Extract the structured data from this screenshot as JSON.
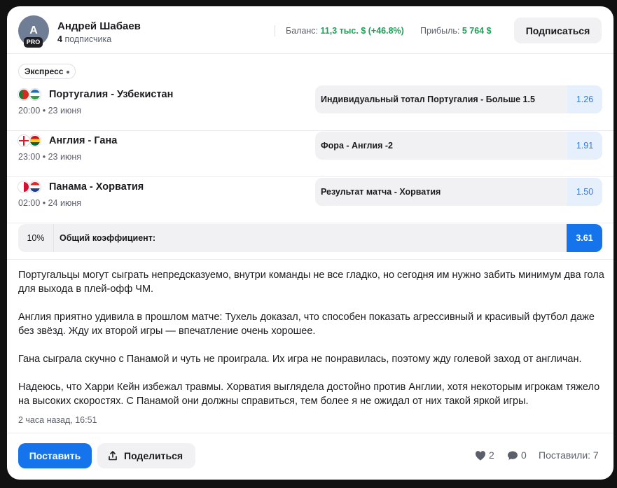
{
  "author": {
    "avatar_letter": "A",
    "badge": "PRO",
    "name": "Андрей Шабаев",
    "subscribers_count": "4",
    "subscribers_label": "подписчика"
  },
  "stats": {
    "balance_label": "Баланс:",
    "balance_value": "11,3 тыс. $ (+46.8%)",
    "profit_label": "Прибыль:",
    "profit_value": "5 764 $"
  },
  "subscribe_label": "Подписаться",
  "bet_type": "Экспресс",
  "matches": [
    {
      "title": "Португалия - Узбекистан",
      "time": "20:00 • 23 июня",
      "pick": "Индивидуальный тотал Португалия - Больше 1.5",
      "odds": "1.26",
      "flag_icons": [
        "portugal-flag-icon",
        "uzbekistan-flag-icon"
      ]
    },
    {
      "title": "Англия - Гана",
      "time": "23:00 • 23 июня",
      "pick": "Фора - Англия -2",
      "odds": "1.91",
      "flag_icons": [
        "england-flag-icon",
        "ghana-flag-icon"
      ]
    },
    {
      "title": "Панама - Хорватия",
      "time": "02:00 • 24 июня",
      "pick": "Результат матча - Хорватия",
      "odds": "1.50",
      "flag_icons": [
        "panama-flag-icon",
        "croatia-flag-icon"
      ]
    }
  ],
  "total": {
    "stake_percent": "10%",
    "label": "Общий коэффициент:",
    "odds": "3.61"
  },
  "description": [
    "Португальцы могут сыграть непредсказуемо, внутри команды не все гладко, но сегодня им нужно забить минимум два гола для выхода в плей-офф ЧМ.",
    "Англия приятно удивила в прошлом матче: Тухель доказал, что способен показать агрессивный и красивый футбол даже без звёзд. Жду их второй игры — впечатление очень хорошее.",
    "Гана сыграла скучно с Панамой и чуть не проиграла. Их игра не понравилась, поэтому жду голевой заход от англичан.",
    "Надеюсь, что Харри Кейн избежал травмы. Хорватия выглядела достойно против Англии, хотя некоторым игрокам тяжело на высоких скоростях. С Панамой они должны справиться, тем более я не ожидал от них такой яркой игры."
  ],
  "posted_time": "2 часа назад, 16:51",
  "actions": {
    "place_label": "Поставить",
    "share_label": "Поделиться",
    "likes": "2",
    "comments": "0",
    "placed_label": "Поставили: 7"
  },
  "colors": {
    "accent_blue": "#1574ec",
    "positive_green": "#1fa058",
    "odds_text": "#2a7be8"
  }
}
